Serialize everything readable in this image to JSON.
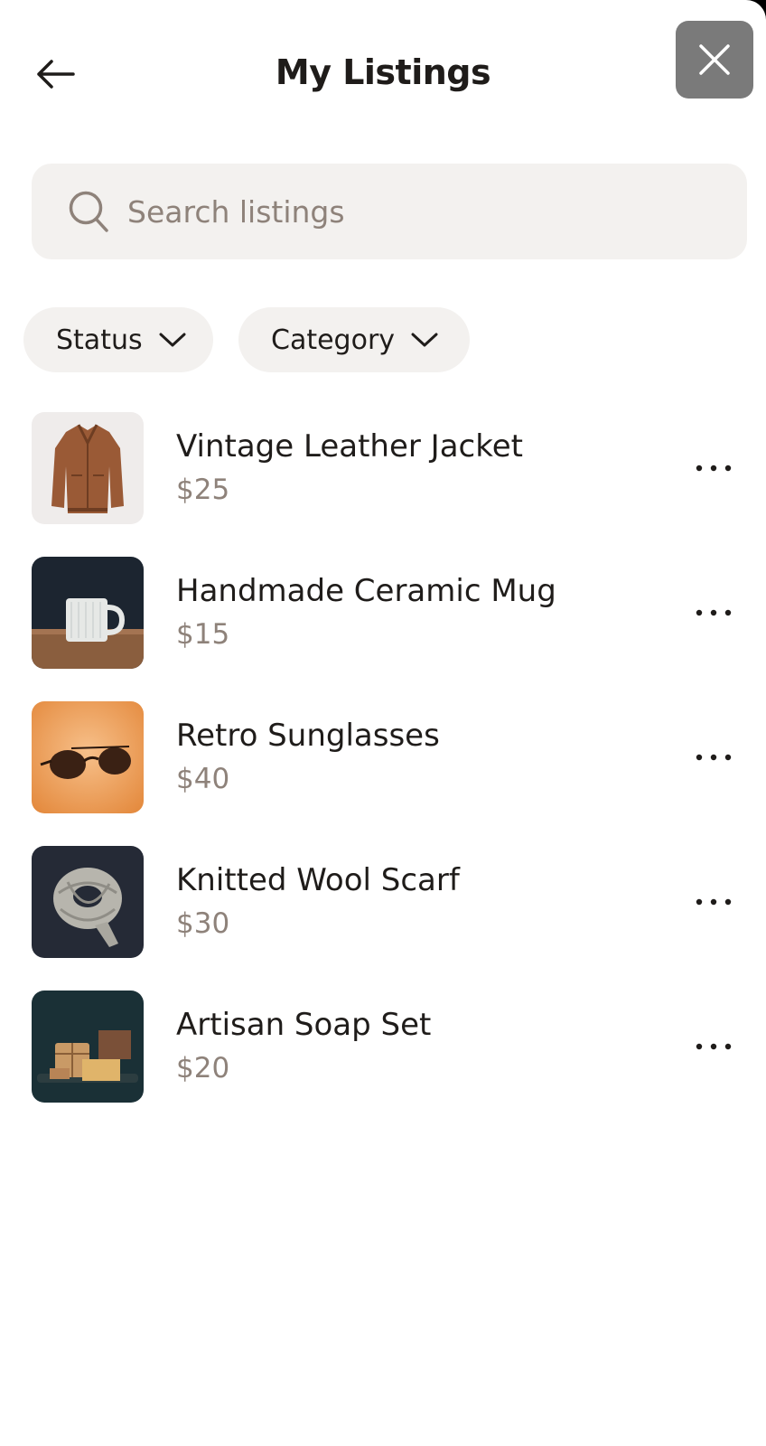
{
  "header": {
    "title": "My Listings",
    "back_icon": "arrow-left-icon",
    "close_icon": "close-icon"
  },
  "search": {
    "placeholder": "Search listings",
    "value": ""
  },
  "filters": [
    {
      "label": "Status"
    },
    {
      "label": "Category"
    }
  ],
  "listings": [
    {
      "title": "Vintage Leather Jacket",
      "price": "$25",
      "image": "leather-jacket-photo"
    },
    {
      "title": "Handmade Ceramic Mug",
      "price": "$15",
      "image": "ceramic-mug-photo"
    },
    {
      "title": "Retro Sunglasses",
      "price": "$40",
      "image": "sunglasses-photo"
    },
    {
      "title": "Knitted Wool Scarf",
      "price": "$30",
      "image": "wool-scarf-photo"
    },
    {
      "title": "Artisan Soap Set",
      "price": "$20",
      "image": "soap-set-photo"
    }
  ],
  "colors": {
    "text": "#1f1c1a",
    "muted": "#8e827a",
    "surface": "#f3f1ef",
    "close_button": "#7a7a7a"
  }
}
